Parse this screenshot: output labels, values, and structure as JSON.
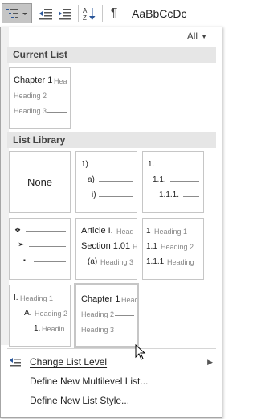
{
  "ribbon": {
    "style_preview": "AaBbCcDc",
    "pilcrow": "¶"
  },
  "filter": {
    "label": "All"
  },
  "sections": {
    "current_list": "Current List",
    "list_library": "List Library"
  },
  "current_list": {
    "lines": [
      "Chapter 1",
      "Hea",
      "Heading 2",
      "Heading 3"
    ]
  },
  "library": {
    "none": "None",
    "numbered": [
      "1)",
      "a)",
      "i)"
    ],
    "decimal": [
      "1.",
      "1.1.",
      "1.1.1."
    ],
    "bullets": [
      "❖",
      "➢",
      "▪"
    ],
    "article": [
      "Article I.",
      "Head",
      "Section 1.01",
      "H",
      "(a)",
      "Heading 3"
    ],
    "heading_numbered": [
      "1",
      "Heading 1",
      "1.1",
      "Heading 2",
      "1.1.1",
      "Heading"
    ],
    "roman": [
      "I.",
      "Heading 1",
      "A.",
      "Heading 2",
      "1.",
      "Headin"
    ],
    "chapter": [
      "Chapter 1",
      "Head",
      "Heading 2",
      "Heading 3"
    ]
  },
  "menu": {
    "change_level": "Change List Level",
    "define_multilevel": "Define New Multilevel List...",
    "define_style": "Define New List Style..."
  }
}
